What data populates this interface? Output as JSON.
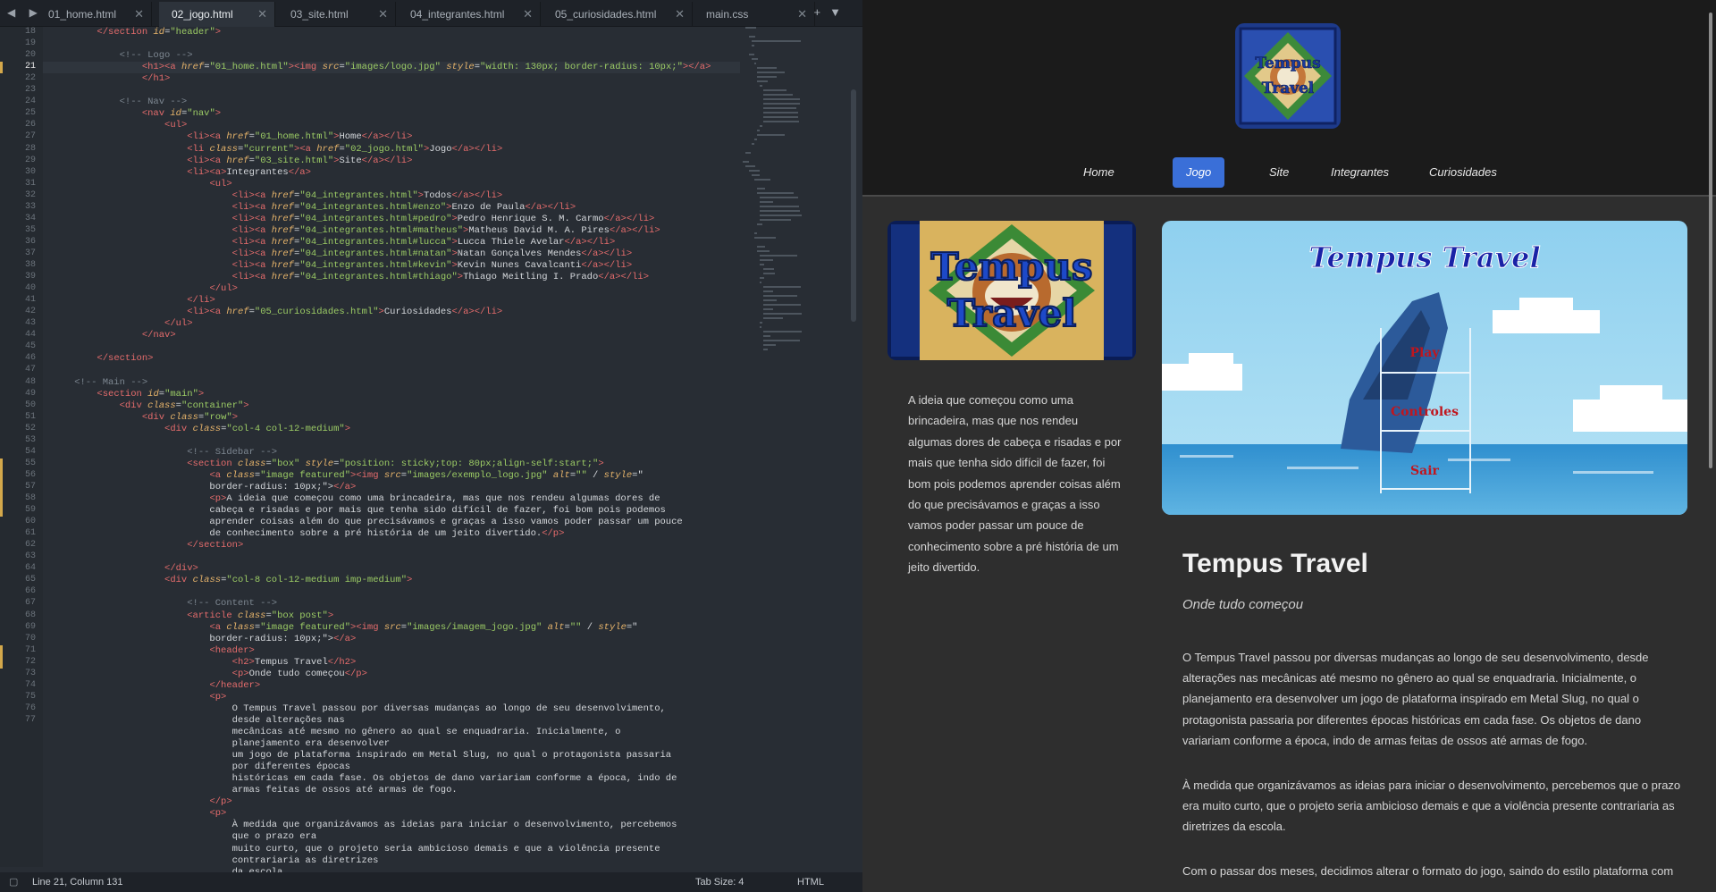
{
  "editor": {
    "tabs": [
      {
        "label": "01_home.html",
        "active": false
      },
      {
        "label": "02_jogo.html",
        "active": true
      },
      {
        "label": "03_site.html",
        "active": false
      },
      {
        "label": "04_integrantes.html",
        "active": false
      },
      {
        "label": "05_curiosidades.html",
        "active": false
      },
      {
        "label": "main.css",
        "active": false
      }
    ],
    "line_numbers": [
      "18",
      "19",
      "20",
      "21",
      "22",
      "23",
      "24",
      "25",
      "26",
      "27",
      "28",
      "29",
      "30",
      "31",
      "32",
      "33",
      "34",
      "35",
      "36",
      "37",
      "38",
      "39",
      "40",
      "41",
      "42",
      "43",
      "44",
      "45",
      "46",
      "47",
      "48",
      "49",
      "50",
      "51",
      "52",
      "53",
      "54",
      "55",
      "56",
      "57",
      "58",
      "59",
      "60",
      "61",
      "62",
      "63",
      "64",
      "65",
      "66",
      "67",
      "68",
      "69",
      "70",
      "71",
      "72",
      "73",
      "74",
      "75",
      "76",
      "77"
    ],
    "status": {
      "position": "Line 21, Column 131",
      "tab_size": "Tab Size: 4",
      "syntax": "HTML"
    }
  },
  "code_lines": [
    "        </section id=\"header\">",
    "",
    "            <!-- Logo -->",
    "                <h1><a href=\"01_home.html\"><img src=\"images/logo.jpg\" style=\"width: 130px; border-radius: 10px;\"></a>",
    "                </h1>",
    "",
    "            <!-- Nav -->",
    "                <nav id=\"nav\">",
    "                    <ul>",
    "                        <li><a href=\"01_home.html\">Home</a></li>",
    "                        <li class=\"current\"><a href=\"02_jogo.html\">Jogo</a></li>",
    "                        <li><a href=\"03_site.html\">Site</a></li>",
    "                        <li><a>Integrantes</a>",
    "                            <ul>",
    "                                <li><a href=\"04_integrantes.html\">Todos</a></li>",
    "                                <li><a href=\"04_integrantes.html#enzo\">Enzo de Paula</a></li>",
    "                                <li><a href=\"04_integrantes.html#pedro\">Pedro Henrique S. M. Carmo</a></li>",
    "                                <li><a href=\"04_integrantes.html#matheus\">Matheus David M. A. Pires</a></li>",
    "                                <li><a href=\"04_integrantes.html#lucca\">Lucca Thiele Avelar</a></li>",
    "                                <li><a href=\"04_integrantes.html#natan\">Natan Gonçalves Mendes</a></li>",
    "                                <li><a href=\"04_integrantes.html#kevin\">Kevin Nunes Cavalcanti</a></li>",
    "                                <li><a href=\"04_integrantes.html#thiago\">Thiago Meitling I. Prado</a></li>",
    "                            </ul>",
    "                        </li>",
    "                        <li><a href=\"05_curiosidades.html\">Curiosidades</a></li>",
    "                    </ul>",
    "                </nav>",
    "",
    "        </section>",
    "",
    "    <!-- Main -->",
    "        <section id=\"main\">",
    "            <div class=\"container\">",
    "                <div class=\"row\">",
    "                    <div class=\"col-4 col-12-medium\">",
    "",
    "                        <!-- Sidebar -->",
    "                        <section class=\"box\" style=\"position: sticky;top: 80px;align-self:start;\">",
    "                            <a class=\"image featured\"><img src=\"images/exemplo_logo.jpg\" alt=\"\" / style=\"",
    "                            border-radius: 10px;\"></a>",
    "                            <p>A ideia que começou como uma brincadeira, mas que nos rendeu algumas dores de",
    "                            cabeça e risadas e por mais que tenha sido difícil de fazer, foi bom pois podemos",
    "                            aprender coisas além do que precisávamos e graças a isso vamos poder passar um pouce",
    "                            de conhecimento sobre a pré história de um jeito divertido.</p>",
    "                        </section>",
    "",
    "                    </div>",
    "                    <div class=\"col-8 col-12-medium imp-medium\">",
    "",
    "                        <!-- Content -->",
    "                        <article class=\"box post\">",
    "                            <a class=\"image featured\"><img src=\"images/imagem_jogo.jpg\" alt=\"\" / style=\"",
    "                            border-radius: 10px;\"></a>",
    "                            <header>",
    "                                <h2>Tempus Travel</h2>",
    "                                <p>Onde tudo começou</p>",
    "                            </header>",
    "                            <p>",
    "                                O Tempus Travel passou por diversas mudanças ao longo de seu desenvolvimento,",
    "                                desde alterações nas",
    "                                mecânicas até mesmo no gênero ao qual se enquadraria. Inicialmente, o",
    "                                planejamento era desenvolver",
    "                                um jogo de plataforma inspirado em Metal Slug, no qual o protagonista passaria",
    "                                por diferentes épocas",
    "                                históricas em cada fase. Os objetos de dano variariam conforme a época, indo de",
    "                                armas feitas de ossos até armas de fogo.",
    "                            </p>",
    "                            <p>",
    "                                À medida que organizávamos as ideias para iniciar o desenvolvimento, percebemos",
    "                                que o prazo era",
    "                                muito curto, que o projeto seria ambicioso demais e que a violência presente",
    "                                contrariaria as diretrizes",
    "                                da escola"
  ],
  "site": {
    "nav": [
      "Home",
      "Jogo",
      "Site",
      "Integrantes",
      "Curiosidades"
    ],
    "nav_current": "Jogo",
    "logo_text": "Tempus Travel",
    "sidebar_logo_text": [
      "Tempus",
      "Travel"
    ],
    "sidebar_text": "A ideia que começou como uma brincadeira, mas que nos rendeu algumas dores de cabeça e risadas e por mais que tenha sido difícil de fazer, foi bom pois podemos aprender coisas além do que precisávamos e graças a isso vamos poder passar um pouce de conhecimento sobre a pré história de um jeito divertido.",
    "game_title": "Tempus Travel",
    "game_menu": [
      "Play",
      "Controles",
      "Sair"
    ],
    "post_title": "Tempus Travel",
    "post_subtitle": "Onde tudo começou",
    "paragraphs": [
      "O Tempus Travel passou por diversas mudanças ao longo de seu desenvolvimento, desde alterações nas mecânicas até mesmo no gênero ao qual se enquadraria. Inicialmente, o planejamento era desenvolver um jogo de plataforma inspirado em Metal Slug, no qual o protagonista passaria por diferentes épocas históricas em cada fase. Os objetos de dano variariam conforme a época, indo de armas feitas de ossos até armas de fogo.",
      "À medida que organizávamos as ideias para iniciar o desenvolvimento, percebemos que o prazo era muito curto, que o projeto seria ambicioso demais e que a violência presente contrariaria as diretrizes da escola.",
      "Com o passar dos meses, decidimos alterar o formato do jogo, saindo do estilo plataforma com"
    ]
  },
  "colors": {
    "editor_bg": "#282d34",
    "tag": "#e56c6c",
    "attr": "#e4b26a",
    "string": "#9ccc65",
    "comment": "#7d8791",
    "nav_current_bg": "#3a6fd8",
    "preview_bg": "#2e2e2e"
  }
}
